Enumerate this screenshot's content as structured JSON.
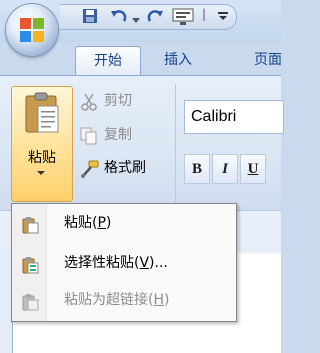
{
  "quick_access": {
    "icons": [
      "save-icon",
      "undo-icon",
      "redo-icon",
      "display-icon",
      "customize-arrow-icon"
    ]
  },
  "tabs": [
    {
      "label": "开始",
      "active": true
    },
    {
      "label": "插入",
      "active": false
    },
    {
      "label": "页面",
      "active": false
    }
  ],
  "clipboard": {
    "paste_label": "粘贴",
    "cut_label": "剪切",
    "copy_label": "复制",
    "format_painter_label": "格式刷"
  },
  "font": {
    "name": "Calibri",
    "bold_label": "B",
    "italic_label": "I",
    "underline_label": "U"
  },
  "paste_menu": {
    "items": [
      {
        "label": "粘贴(",
        "key": "P",
        "suffix": ")",
        "enabled": true
      },
      {
        "label": "选择性粘贴(",
        "key": "V",
        "suffix": ")...",
        "enabled": true
      },
      {
        "label": "粘贴为超链接(",
        "key": "H",
        "suffix": ")",
        "enabled": false
      }
    ]
  }
}
